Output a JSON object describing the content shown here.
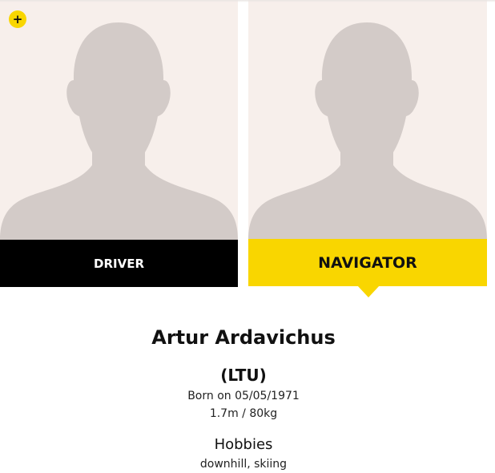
{
  "controls": {
    "plus_label": "+"
  },
  "tabs": [
    {
      "label": "DRIVER",
      "active": false
    },
    {
      "label": "NAVIGATOR",
      "active": true
    }
  ],
  "profile": {
    "name": "Artur Ardavichus",
    "country": "(LTU)",
    "born": "Born on 05/05/1971",
    "measures": "1.7m / 80kg",
    "hobbies_title": "Hobbies",
    "hobbies": "downhill, skiing"
  },
  "colors": {
    "accent": "#f9d600",
    "driver_tab": "#000000",
    "photo_bg": "#f7efeb",
    "silhouette": "#d3cbc8"
  },
  "icons": {
    "plus": "plus-icon",
    "placeholder": "person-silhouette-icon"
  }
}
